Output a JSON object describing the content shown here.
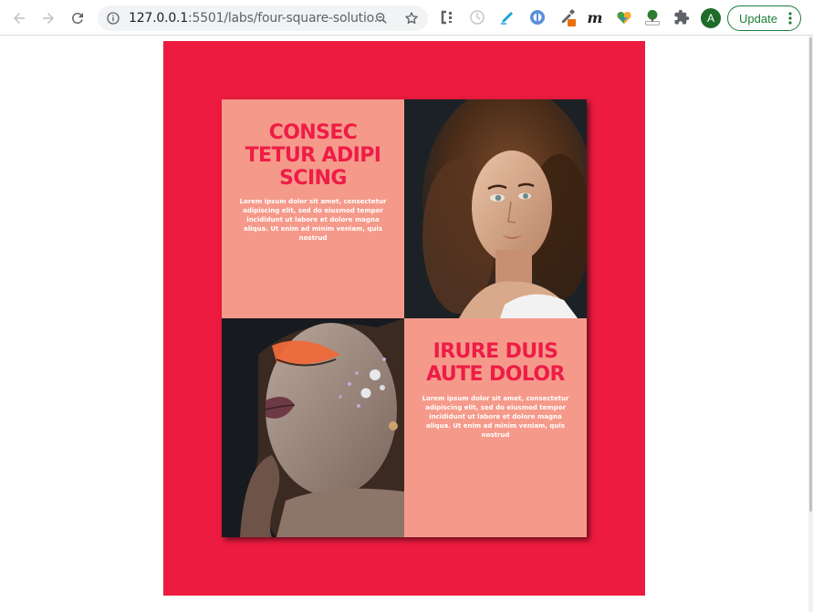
{
  "browser": {
    "url_host": "127.0.0.1",
    "url_rest": ":5501/labs/four-square-solutio...",
    "extension_letter": "m",
    "avatar_letter": "A",
    "update_label": "Update"
  },
  "card": {
    "top_left": {
      "heading": "CONSEC TETUR ADIPI SCING",
      "body": "Lorem ipsum dolor sit amet, consectetur adipiscing elit, sed do eiusmod tempor incididunt ut labore et dolore magna aliqua. Ut enim ad minim veniam, quis nostrud"
    },
    "bottom_right": {
      "heading": "IRURE DUIS AUTE DOLOR",
      "body": "Lorem ipsum dolor sit amet, consectetur adipiscing elit, sed do eiusmod tempor incididunt ut labore et dolore magna aliqua. Ut enim ad minim veniam, quis nostrud"
    }
  },
  "colors": {
    "page_background": "#ed1b3f",
    "tile_background": "#f59a8a",
    "heading": "#ee1c47"
  }
}
